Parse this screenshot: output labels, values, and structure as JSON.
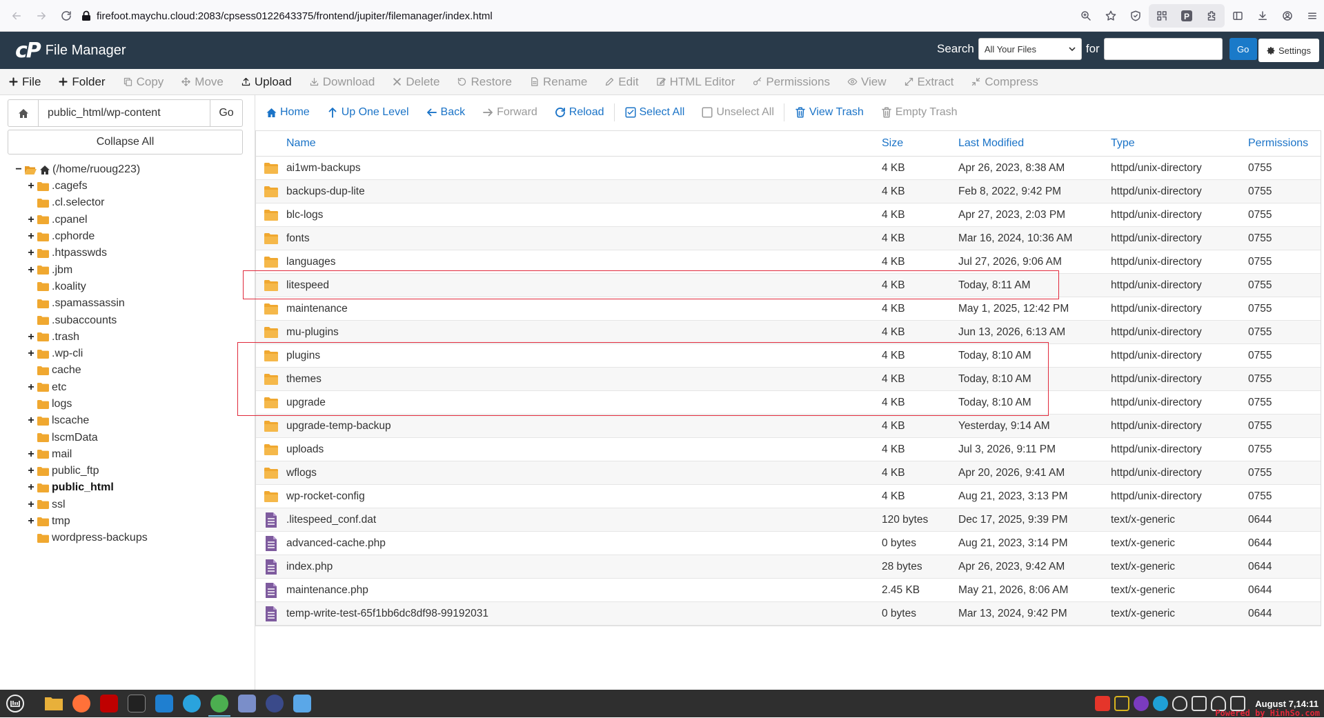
{
  "browser": {
    "url": "firefoot.maychu.cloud:2083/cpsess0122643375/frontend/jupiter/filemanager/index.html"
  },
  "header": {
    "logo": "cP",
    "app_title": "File Manager",
    "search_label": "Search",
    "search_scope": "All Your Files",
    "for_label": "for",
    "search_value": "",
    "go_label": "Go",
    "settings_label": "Settings"
  },
  "toolbar": [
    {
      "label": "File",
      "enabled": true,
      "icon": "plus-icon"
    },
    {
      "label": "Folder",
      "enabled": true,
      "icon": "plus-icon"
    },
    {
      "label": "Copy",
      "enabled": false,
      "icon": "copy-icon"
    },
    {
      "label": "Move",
      "enabled": false,
      "icon": "move-icon"
    },
    {
      "label": "Upload",
      "enabled": true,
      "icon": "upload-icon"
    },
    {
      "label": "Download",
      "enabled": false,
      "icon": "download-icon"
    },
    {
      "label": "Delete",
      "enabled": false,
      "icon": "delete-icon"
    },
    {
      "label": "Restore",
      "enabled": false,
      "icon": "restore-icon"
    },
    {
      "label": "Rename",
      "enabled": false,
      "icon": "rename-icon"
    },
    {
      "label": "Edit",
      "enabled": false,
      "icon": "edit-icon"
    },
    {
      "label": "HTML Editor",
      "enabled": false,
      "icon": "html-editor-icon"
    },
    {
      "label": "Permissions",
      "enabled": false,
      "icon": "key-icon"
    },
    {
      "label": "View",
      "enabled": false,
      "icon": "eye-icon"
    },
    {
      "label": "Extract",
      "enabled": false,
      "icon": "extract-icon"
    },
    {
      "label": "Compress",
      "enabled": false,
      "icon": "compress-icon"
    }
  ],
  "left_panel": {
    "path_value": "public_html/wp-content",
    "go_label": "Go",
    "collapse_label": "Collapse All",
    "root_label": "(/home/ruoug223)",
    "tree": [
      {
        "label": ".cagefs",
        "expandable": true,
        "bold": false
      },
      {
        "label": ".cl.selector",
        "expandable": false,
        "bold": false
      },
      {
        "label": ".cpanel",
        "expandable": true,
        "bold": false
      },
      {
        "label": ".cphorde",
        "expandable": true,
        "bold": false
      },
      {
        "label": ".htpasswds",
        "expandable": true,
        "bold": false
      },
      {
        "label": ".jbm",
        "expandable": true,
        "bold": false
      },
      {
        "label": ".koality",
        "expandable": false,
        "bold": false
      },
      {
        "label": ".spamassassin",
        "expandable": false,
        "bold": false
      },
      {
        "label": ".subaccounts",
        "expandable": false,
        "bold": false
      },
      {
        "label": ".trash",
        "expandable": true,
        "bold": false
      },
      {
        "label": ".wp-cli",
        "expandable": true,
        "bold": false
      },
      {
        "label": "cache",
        "expandable": false,
        "bold": false
      },
      {
        "label": "etc",
        "expandable": true,
        "bold": false
      },
      {
        "label": "logs",
        "expandable": false,
        "bold": false
      },
      {
        "label": "lscache",
        "expandable": true,
        "bold": false
      },
      {
        "label": "lscmData",
        "expandable": false,
        "bold": false
      },
      {
        "label": "mail",
        "expandable": true,
        "bold": false
      },
      {
        "label": "public_ftp",
        "expandable": true,
        "bold": false
      },
      {
        "label": "public_html",
        "expandable": true,
        "bold": true
      },
      {
        "label": "ssl",
        "expandable": true,
        "bold": false
      },
      {
        "label": "tmp",
        "expandable": true,
        "bold": false
      },
      {
        "label": "wordpress-backups",
        "expandable": false,
        "bold": false
      }
    ]
  },
  "actions": [
    {
      "label": "Home",
      "enabled": true,
      "icon": "home-icon"
    },
    {
      "label": "Up One Level",
      "enabled": true,
      "icon": "up-arrow-icon"
    },
    {
      "label": "Back",
      "enabled": true,
      "icon": "back-arrow-icon"
    },
    {
      "label": "Forward",
      "enabled": false,
      "icon": "forward-arrow-icon"
    },
    {
      "label": "Reload",
      "enabled": true,
      "icon": "reload-icon"
    },
    {
      "label": "Select All",
      "enabled": true,
      "icon": "checkbox-checked-icon"
    },
    {
      "label": "Unselect All",
      "enabled": false,
      "icon": "checkbox-empty-icon"
    },
    {
      "label": "View Trash",
      "enabled": true,
      "icon": "trash-icon"
    },
    {
      "label": "Empty Trash",
      "enabled": false,
      "icon": "trash-icon"
    }
  ],
  "table": {
    "columns": [
      "Name",
      "Size",
      "Last Modified",
      "Type",
      "Permissions"
    ],
    "rows": [
      {
        "kind": "folder",
        "name": "ai1wm-backups",
        "size": "4 KB",
        "modified": "Apr 26, 2023, 8:38 AM",
        "type": "httpd/unix-directory",
        "perm": "0755"
      },
      {
        "kind": "folder",
        "name": "backups-dup-lite",
        "size": "4 KB",
        "modified": "Feb 8, 2022, 9:42 PM",
        "type": "httpd/unix-directory",
        "perm": "0755"
      },
      {
        "kind": "folder",
        "name": "blc-logs",
        "size": "4 KB",
        "modified": "Apr 27, 2023, 2:03 PM",
        "type": "httpd/unix-directory",
        "perm": "0755"
      },
      {
        "kind": "folder",
        "name": "fonts",
        "size": "4 KB",
        "modified": "Mar 16, 2024, 10:36 AM",
        "type": "httpd/unix-directory",
        "perm": "0755"
      },
      {
        "kind": "folder",
        "name": "languages",
        "size": "4 KB",
        "modified": "Jul 27, 2026, 9:06 AM",
        "type": "httpd/unix-directory",
        "perm": "0755"
      },
      {
        "kind": "folder",
        "name": "litespeed",
        "size": "4 KB",
        "modified": "Today, 8:11 AM",
        "type": "httpd/unix-directory",
        "perm": "0755"
      },
      {
        "kind": "folder",
        "name": "maintenance",
        "size": "4 KB",
        "modified": "May 1, 2025, 12:42 PM",
        "type": "httpd/unix-directory",
        "perm": "0755"
      },
      {
        "kind": "folder",
        "name": "mu-plugins",
        "size": "4 KB",
        "modified": "Jun 13, 2026, 6:13 AM",
        "type": "httpd/unix-directory",
        "perm": "0755"
      },
      {
        "kind": "folder",
        "name": "plugins",
        "size": "4 KB",
        "modified": "Today, 8:10 AM",
        "type": "httpd/unix-directory",
        "perm": "0755"
      },
      {
        "kind": "folder",
        "name": "themes",
        "size": "4 KB",
        "modified": "Today, 8:10 AM",
        "type": "httpd/unix-directory",
        "perm": "0755"
      },
      {
        "kind": "folder",
        "name": "upgrade",
        "size": "4 KB",
        "modified": "Today, 8:10 AM",
        "type": "httpd/unix-directory",
        "perm": "0755"
      },
      {
        "kind": "folder",
        "name": "upgrade-temp-backup",
        "size": "4 KB",
        "modified": "Yesterday, 9:14 AM",
        "type": "httpd/unix-directory",
        "perm": "0755"
      },
      {
        "kind": "folder",
        "name": "uploads",
        "size": "4 KB",
        "modified": "Jul 3, 2026, 9:11 PM",
        "type": "httpd/unix-directory",
        "perm": "0755"
      },
      {
        "kind": "folder",
        "name": "wflogs",
        "size": "4 KB",
        "modified": "Apr 20, 2026, 9:41 AM",
        "type": "httpd/unix-directory",
        "perm": "0755"
      },
      {
        "kind": "folder",
        "name": "wp-rocket-config",
        "size": "4 KB",
        "modified": "Aug 21, 2023, 3:13 PM",
        "type": "httpd/unix-directory",
        "perm": "0755"
      },
      {
        "kind": "file",
        "name": ".litespeed_conf.dat",
        "size": "120 bytes",
        "modified": "Dec 17, 2025, 9:39 PM",
        "type": "text/x-generic",
        "perm": "0644"
      },
      {
        "kind": "file",
        "name": "advanced-cache.php",
        "size": "0 bytes",
        "modified": "Aug 21, 2023, 3:14 PM",
        "type": "text/x-generic",
        "perm": "0644"
      },
      {
        "kind": "file",
        "name": "index.php",
        "size": "28 bytes",
        "modified": "Apr 26, 2023, 9:42 AM",
        "type": "text/x-generic",
        "perm": "0644"
      },
      {
        "kind": "file",
        "name": "maintenance.php",
        "size": "2.45 KB",
        "modified": "May 21, 2026, 8:06 AM",
        "type": "text/x-generic",
        "perm": "0644"
      },
      {
        "kind": "file",
        "name": "temp-write-test-65f1bb6dc8df98-99192031",
        "size": "0 bytes",
        "modified": "Mar 13, 2024, 9:42 PM",
        "type": "text/x-generic",
        "perm": "0644"
      }
    ]
  },
  "taskbar": {
    "clock": "August  7,14:11",
    "watermark": "Powered by HinhSo.com"
  },
  "colors": {
    "header_bg": "#293a4a",
    "link_blue": "#1a73c7",
    "folder": "#f0a830",
    "file_icon": "#7e5b9e",
    "highlight_red": "#e0283a"
  }
}
